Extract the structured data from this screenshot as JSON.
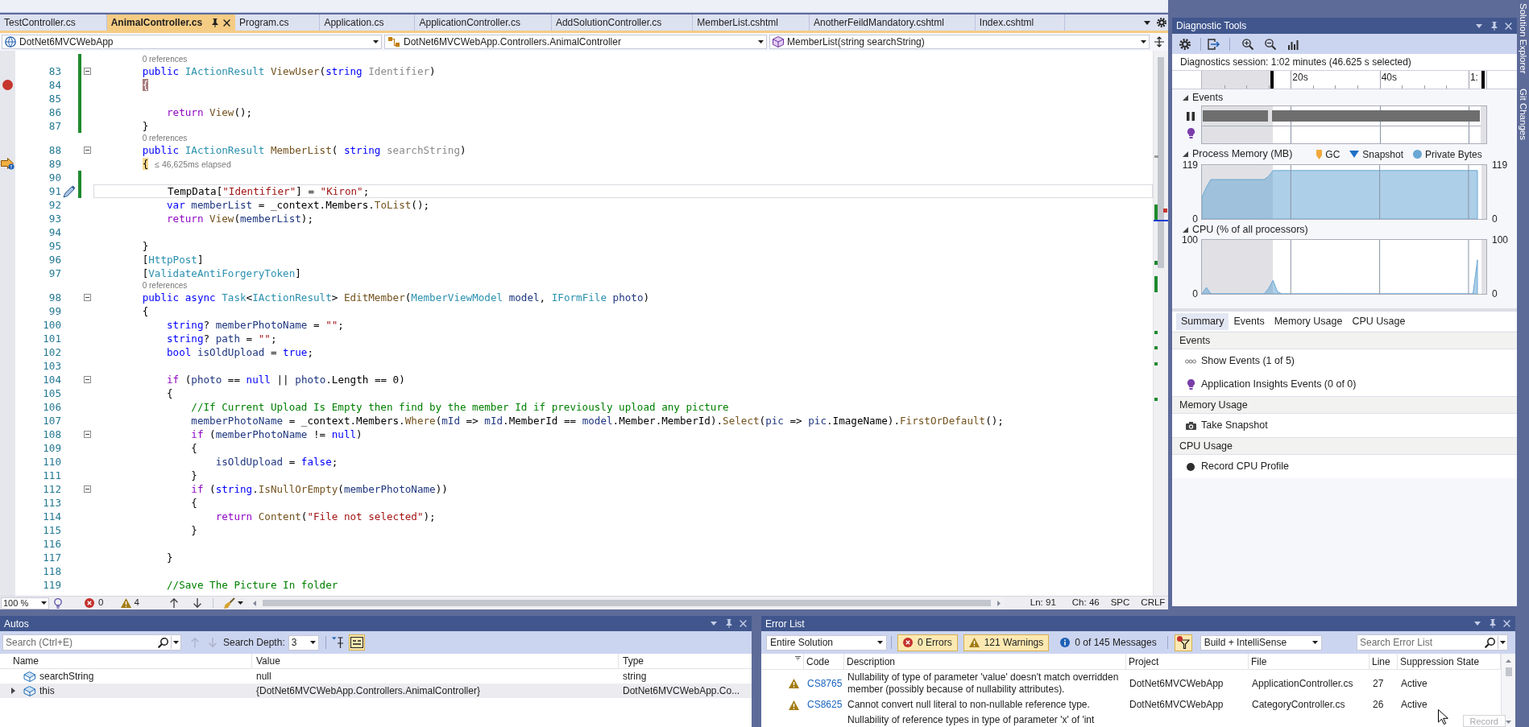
{
  "tabs": [
    {
      "label": "TestController.cs",
      "selected": false
    },
    {
      "label": "AnimalController.cs",
      "selected": true
    },
    {
      "label": "Program.cs",
      "selected": false
    },
    {
      "label": "Application.cs",
      "selected": false
    },
    {
      "label": "ApplicationController.cs",
      "selected": false
    },
    {
      "label": "AddSolutionController.cs",
      "selected": false
    },
    {
      "label": "MemberList.cshtml",
      "selected": false
    },
    {
      "label": "AnotherFeildMandatory.cshtml",
      "selected": false
    },
    {
      "label": "Index.cshtml",
      "selected": false
    }
  ],
  "navigation_bar": [
    {
      "kind": "project",
      "text": "DotNet6MVCWebApp"
    },
    {
      "kind": "type",
      "text": "DotNet6MVCWebApp.Controllers.AnimalController"
    },
    {
      "kind": "member",
      "text": "MemberList(string searchString)"
    }
  ],
  "editor": {
    "lines": [
      {
        "kind": "codelens",
        "text": "0 references",
        "changed": true
      },
      {
        "kind": "code",
        "number": "83",
        "changed": true,
        "collapsible": true,
        "current": false,
        "breakpoint": false,
        "current_statement": false,
        "edited": false,
        "tokens": [
          {
            "kind": "keyword",
            "text": "        public "
          },
          {
            "kind": "type",
            "text": "IActionResult "
          },
          {
            "kind": "method",
            "text": "ViewUser"
          },
          {
            "kind": "plain",
            "text": "("
          },
          {
            "kind": "keyword",
            "text": "string "
          },
          {
            "kind": "unused",
            "text": "Identifier"
          },
          {
            "kind": "plain",
            "text": ")"
          }
        ]
      },
      {
        "kind": "code",
        "number": "84",
        "changed": true,
        "collapsible": false,
        "current": false,
        "breakpoint": true,
        "current_statement": false,
        "edited": false,
        "tokens": [
          {
            "kind": "breakpoint_brace",
            "text": "        {"
          }
        ]
      },
      {
        "kind": "code",
        "number": "85",
        "changed": true,
        "collapsible": false,
        "current": false,
        "breakpoint": false,
        "current_statement": false,
        "edited": false
      },
      {
        "kind": "code",
        "number": "86",
        "changed": true,
        "collapsible": false,
        "current": false,
        "breakpoint": false,
        "current_statement": false,
        "edited": false,
        "tokens": [
          {
            "kind": "control",
            "text": "            return "
          },
          {
            "kind": "method",
            "text": "View"
          },
          {
            "kind": "plain",
            "text": "();"
          }
        ]
      },
      {
        "kind": "code",
        "number": "87",
        "changed": true,
        "collapsible": false,
        "current": false,
        "breakpoint": false,
        "current_statement": false,
        "edited": false,
        "tokens": [
          {
            "kind": "plain",
            "text": "        }"
          }
        ]
      },
      {
        "kind": "codelens",
        "text": "0 references",
        "changed": false
      },
      {
        "kind": "code",
        "number": "88",
        "changed": false,
        "collapsible": true,
        "current": false,
        "breakpoint": false,
        "current_statement": false,
        "edited": false,
        "tokens": [
          {
            "kind": "keyword",
            "text": "        public "
          },
          {
            "kind": "type",
            "text": "IActionResult "
          },
          {
            "kind": "method",
            "text": "MemberList"
          },
          {
            "kind": "plain",
            "text": "( "
          },
          {
            "kind": "keyword",
            "text": "string "
          },
          {
            "kind": "unused",
            "text": "searchString"
          },
          {
            "kind": "plain",
            "text": ")"
          }
        ]
      },
      {
        "kind": "code",
        "number": "89",
        "changed": false,
        "collapsible": false,
        "current": false,
        "breakpoint": false,
        "current_statement": true,
        "edited": false,
        "perf_tip": "≤ 46,625ms elapsed",
        "tokens": [
          {
            "kind": "current_brace",
            "text": "        {"
          }
        ]
      },
      {
        "kind": "code",
        "number": "90",
        "changed": true,
        "collapsible": false,
        "current": false,
        "breakpoint": false,
        "current_statement": false,
        "edited": false
      },
      {
        "kind": "code",
        "number": "91",
        "changed": true,
        "collapsible": false,
        "current": true,
        "breakpoint": false,
        "current_statement": false,
        "edited": true,
        "tokens": [
          {
            "kind": "plain",
            "text": "            TempData["
          },
          {
            "kind": "string",
            "text": "\"Identifier\""
          },
          {
            "kind": "plain",
            "text": "] = "
          },
          {
            "kind": "string",
            "text": "\"Kiron\""
          },
          {
            "kind": "plain",
            "text": ";"
          }
        ]
      },
      {
        "kind": "code",
        "number": "92",
        "changed": false,
        "collapsible": false,
        "current": false,
        "breakpoint": false,
        "current_statement": false,
        "edited": false,
        "tokens": [
          {
            "kind": "keyword",
            "text": "            var "
          },
          {
            "kind": "local",
            "text": "memberList"
          },
          {
            "kind": "plain",
            "text": " = _context.Members."
          },
          {
            "kind": "method",
            "text": "ToList"
          },
          {
            "kind": "plain",
            "text": "();"
          }
        ]
      },
      {
        "kind": "code",
        "number": "93",
        "changed": false,
        "collapsible": false,
        "current": false,
        "breakpoint": false,
        "current_statement": false,
        "edited": false,
        "tokens": [
          {
            "kind": "control",
            "text": "            return "
          },
          {
            "kind": "method",
            "text": "View"
          },
          {
            "kind": "plain",
            "text": "("
          },
          {
            "kind": "local",
            "text": "memberList"
          },
          {
            "kind": "plain",
            "text": ");"
          }
        ]
      },
      {
        "kind": "code",
        "number": "94",
        "changed": false,
        "collapsible": false,
        "current": false,
        "breakpoint": false,
        "current_statement": false,
        "edited": false
      },
      {
        "kind": "code",
        "number": "95",
        "changed": false,
        "collapsible": false,
        "current": false,
        "breakpoint": false,
        "current_statement": false,
        "edited": false,
        "tokens": [
          {
            "kind": "plain",
            "text": "        }"
          }
        ]
      },
      {
        "kind": "code",
        "number": "96",
        "changed": false,
        "collapsible": false,
        "current": false,
        "breakpoint": false,
        "current_statement": false,
        "edited": false,
        "tokens": [
          {
            "kind": "plain",
            "text": "        ["
          },
          {
            "kind": "type",
            "text": "HttpPost"
          },
          {
            "kind": "plain",
            "text": "]"
          }
        ]
      },
      {
        "kind": "code",
        "number": "97",
        "changed": false,
        "collapsible": false,
        "current": false,
        "breakpoint": false,
        "current_statement": false,
        "edited": false,
        "tokens": [
          {
            "kind": "plain",
            "text": "        ["
          },
          {
            "kind": "type",
            "text": "ValidateAntiForgeryToken"
          },
          {
            "kind": "plain",
            "text": "]"
          }
        ]
      },
      {
        "kind": "codelens",
        "text": "0 references",
        "changed": false
      },
      {
        "kind": "code",
        "number": "98",
        "changed": false,
        "collapsible": true,
        "current": false,
        "breakpoint": false,
        "current_statement": false,
        "edited": false,
        "tokens": [
          {
            "kind": "keyword",
            "text": "        public async "
          },
          {
            "kind": "type",
            "text": "Task"
          },
          {
            "kind": "plain",
            "text": "<"
          },
          {
            "kind": "type",
            "text": "IActionResult"
          },
          {
            "kind": "plain",
            "text": "> "
          },
          {
            "kind": "method",
            "text": "EditMember"
          },
          {
            "kind": "plain",
            "text": "("
          },
          {
            "kind": "type",
            "text": "MemberViewModel "
          },
          {
            "kind": "local",
            "text": "model"
          },
          {
            "kind": "plain",
            "text": ", "
          },
          {
            "kind": "type",
            "text": "IFormFile "
          },
          {
            "kind": "local",
            "text": "photo"
          },
          {
            "kind": "plain",
            "text": ")"
          }
        ]
      },
      {
        "kind": "code",
        "number": "99",
        "changed": false,
        "collapsible": false,
        "current": false,
        "breakpoint": false,
        "current_statement": false,
        "edited": false,
        "tokens": [
          {
            "kind": "plain",
            "text": "        {"
          }
        ]
      },
      {
        "kind": "code",
        "number": "100",
        "changed": false,
        "collapsible": false,
        "current": false,
        "breakpoint": false,
        "current_statement": false,
        "edited": false,
        "tokens": [
          {
            "kind": "keyword",
            "text": "            string"
          },
          {
            "kind": "plain",
            "text": "? "
          },
          {
            "kind": "local",
            "text": "memberPhotoName"
          },
          {
            "kind": "plain",
            "text": " = "
          },
          {
            "kind": "string",
            "text": "\"\""
          },
          {
            "kind": "plain",
            "text": ";"
          }
        ]
      },
      {
        "kind": "code",
        "number": "101",
        "changed": false,
        "collapsible": false,
        "current": false,
        "breakpoint": false,
        "current_statement": false,
        "edited": false,
        "tokens": [
          {
            "kind": "keyword",
            "text": "            string"
          },
          {
            "kind": "plain",
            "text": "? "
          },
          {
            "kind": "local",
            "text": "path"
          },
          {
            "kind": "plain",
            "text": " = "
          },
          {
            "kind": "string",
            "text": "\"\""
          },
          {
            "kind": "plain",
            "text": ";"
          }
        ]
      },
      {
        "kind": "code",
        "number": "102",
        "changed": false,
        "collapsible": false,
        "current": false,
        "breakpoint": false,
        "current_statement": false,
        "edited": false,
        "tokens": [
          {
            "kind": "keyword",
            "text": "            bool "
          },
          {
            "kind": "local",
            "text": "isOldUpload"
          },
          {
            "kind": "plain",
            "text": " = "
          },
          {
            "kind": "keyword",
            "text": "true"
          },
          {
            "kind": "plain",
            "text": ";"
          }
        ]
      },
      {
        "kind": "code",
        "number": "103",
        "changed": false,
        "collapsible": false,
        "current": false,
        "breakpoint": false,
        "current_statement": false,
        "edited": false
      },
      {
        "kind": "code",
        "number": "104",
        "changed": false,
        "collapsible": true,
        "current": false,
        "breakpoint": false,
        "current_statement": false,
        "edited": false,
        "tokens": [
          {
            "kind": "control",
            "text": "            if "
          },
          {
            "kind": "plain",
            "text": "("
          },
          {
            "kind": "local",
            "text": "photo"
          },
          {
            "kind": "plain",
            "text": " == "
          },
          {
            "kind": "keyword",
            "text": "null"
          },
          {
            "kind": "plain",
            "text": " || "
          },
          {
            "kind": "local",
            "text": "photo"
          },
          {
            "kind": "plain",
            "text": ".Length == 0)"
          }
        ]
      },
      {
        "kind": "code",
        "number": "105",
        "changed": false,
        "collapsible": false,
        "current": false,
        "breakpoint": false,
        "current_statement": false,
        "edited": false,
        "tokens": [
          {
            "kind": "plain",
            "text": "            {"
          }
        ]
      },
      {
        "kind": "code",
        "number": "106",
        "changed": false,
        "collapsible": false,
        "current": false,
        "breakpoint": false,
        "current_statement": false,
        "edited": false,
        "tokens": [
          {
            "kind": "comment",
            "text": "                //If Current Upload Is Empty then find by the member Id if previously upload any picture"
          }
        ]
      },
      {
        "kind": "code",
        "number": "107",
        "changed": false,
        "collapsible": false,
        "current": false,
        "breakpoint": false,
        "current_statement": false,
        "edited": false,
        "tokens": [
          {
            "kind": "local",
            "text": "                memberPhotoName"
          },
          {
            "kind": "plain",
            "text": " = _context.Members."
          },
          {
            "kind": "method",
            "text": "Where"
          },
          {
            "kind": "plain",
            "text": "("
          },
          {
            "kind": "local",
            "text": "mId"
          },
          {
            "kind": "plain",
            "text": " => "
          },
          {
            "kind": "local",
            "text": "mId"
          },
          {
            "kind": "plain",
            "text": ".MemberId == "
          },
          {
            "kind": "local",
            "text": "model"
          },
          {
            "kind": "plain",
            "text": ".Member.MemberId)."
          },
          {
            "kind": "method",
            "text": "Select"
          },
          {
            "kind": "plain",
            "text": "("
          },
          {
            "kind": "local",
            "text": "pic"
          },
          {
            "kind": "plain",
            "text": " => "
          },
          {
            "kind": "local",
            "text": "pic"
          },
          {
            "kind": "plain",
            "text": ".ImageName)."
          },
          {
            "kind": "method",
            "text": "FirstOrDefault"
          },
          {
            "kind": "plain",
            "text": "();"
          }
        ]
      },
      {
        "kind": "code",
        "number": "108",
        "changed": false,
        "collapsible": true,
        "current": false,
        "breakpoint": false,
        "current_statement": false,
        "edited": false,
        "tokens": [
          {
            "kind": "control",
            "text": "                if "
          },
          {
            "kind": "plain",
            "text": "("
          },
          {
            "kind": "local",
            "text": "memberPhotoName"
          },
          {
            "kind": "plain",
            "text": " != "
          },
          {
            "kind": "keyword",
            "text": "null"
          },
          {
            "kind": "plain",
            "text": ")"
          }
        ]
      },
      {
        "kind": "code",
        "number": "109",
        "changed": false,
        "collapsible": false,
        "current": false,
        "breakpoint": false,
        "current_statement": false,
        "edited": false,
        "tokens": [
          {
            "kind": "plain",
            "text": "                {"
          }
        ]
      },
      {
        "kind": "code",
        "number": "110",
        "changed": false,
        "collapsible": false,
        "current": false,
        "breakpoint": false,
        "current_statement": false,
        "edited": false,
        "tokens": [
          {
            "kind": "local",
            "text": "                    isOldUpload"
          },
          {
            "kind": "plain",
            "text": " = "
          },
          {
            "kind": "keyword",
            "text": "false"
          },
          {
            "kind": "plain",
            "text": ";"
          }
        ]
      },
      {
        "kind": "code",
        "number": "111",
        "changed": false,
        "collapsible": false,
        "current": false,
        "breakpoint": false,
        "current_statement": false,
        "edited": false,
        "tokens": [
          {
            "kind": "plain",
            "text": "                }"
          }
        ]
      },
      {
        "kind": "code",
        "number": "112",
        "changed": false,
        "collapsible": true,
        "current": false,
        "breakpoint": false,
        "current_statement": false,
        "edited": false,
        "tokens": [
          {
            "kind": "control",
            "text": "                if "
          },
          {
            "kind": "plain",
            "text": "("
          },
          {
            "kind": "keyword",
            "text": "string"
          },
          {
            "kind": "plain",
            "text": "."
          },
          {
            "kind": "method",
            "text": "IsNullOrEmpty"
          },
          {
            "kind": "plain",
            "text": "("
          },
          {
            "kind": "local",
            "text": "memberPhotoName"
          },
          {
            "kind": "plain",
            "text": "))"
          }
        ]
      },
      {
        "kind": "code",
        "number": "113",
        "changed": false,
        "collapsible": false,
        "current": false,
        "breakpoint": false,
        "current_statement": false,
        "edited": false,
        "tokens": [
          {
            "kind": "plain",
            "text": "                {"
          }
        ]
      },
      {
        "kind": "code",
        "number": "114",
        "changed": false,
        "collapsible": false,
        "current": false,
        "breakpoint": false,
        "current_statement": false,
        "edited": false,
        "tokens": [
          {
            "kind": "control",
            "text": "                    return "
          },
          {
            "kind": "method",
            "text": "Content"
          },
          {
            "kind": "plain",
            "text": "("
          },
          {
            "kind": "string",
            "text": "\"File not selected\""
          },
          {
            "kind": "plain",
            "text": ");"
          }
        ]
      },
      {
        "kind": "code",
        "number": "115",
        "changed": false,
        "collapsible": false,
        "current": false,
        "breakpoint": false,
        "current_statement": false,
        "edited": false,
        "tokens": [
          {
            "kind": "plain",
            "text": "                }"
          }
        ]
      },
      {
        "kind": "code",
        "number": "116",
        "changed": false,
        "collapsible": false,
        "current": false,
        "breakpoint": false,
        "current_statement": false,
        "edited": false
      },
      {
        "kind": "code",
        "number": "117",
        "changed": false,
        "collapsible": false,
        "current": false,
        "breakpoint": false,
        "current_statement": false,
        "edited": false,
        "tokens": [
          {
            "kind": "plain",
            "text": "            }"
          }
        ]
      },
      {
        "kind": "code",
        "number": "118",
        "changed": false,
        "collapsible": false,
        "current": false,
        "breakpoint": false,
        "current_statement": false,
        "edited": false
      },
      {
        "kind": "code",
        "number": "119",
        "changed": false,
        "collapsible": false,
        "current": false,
        "breakpoint": false,
        "current_statement": false,
        "edited": false,
        "tokens": [
          {
            "kind": "comment",
            "text": "            //Save The Picture In folder"
          }
        ]
      }
    ],
    "status_bar": {
      "zoom": "100 %",
      "errors": "0",
      "warnings": "4",
      "line": "Ln: 91",
      "column": "Ch: 46",
      "whitespace": "SPC",
      "line_ending": "CRLF"
    }
  },
  "diagnostic_tools": {
    "title": "Diagnostic Tools",
    "session": "Diagnostics session: 1:02 minutes (46.625 s selected)",
    "timeline_ticks": [
      "20s",
      "40s",
      "1:"
    ],
    "events_title": "Events",
    "memory": {
      "title": "Process Memory (MB)",
      "legend": [
        {
          "kind": "gc",
          "label": "GC"
        },
        {
          "kind": "snapshot",
          "label": "Snapshot"
        },
        {
          "kind": "private_bytes",
          "label": "Private Bytes"
        }
      ],
      "axis_labels": [
        "119",
        "0"
      ],
      "right_axis_labels": [
        "119",
        "0"
      ]
    },
    "cpu": {
      "right_axis_labels": [
        "100",
        "0"
      ],
      "chart_data": {
        "type": "area",
        "title": "CPU (% of all processors)",
        "categories": [
          null,
          null,
          null,
          null,
          null,
          null,
          null,
          null,
          null,
          null,
          null,
          null,
          null,
          null,
          null,
          null,
          null,
          null,
          null,
          null,
          null,
          null,
          null,
          null,
          null,
          null,
          null,
          null,
          null,
          null,
          null,
          null,
          null,
          null,
          null,
          null,
          null,
          null,
          null,
          null,
          null,
          null,
          null,
          null,
          null,
          null,
          null,
          null,
          null,
          null,
          null,
          null,
          null,
          null,
          null,
          null,
          null,
          null,
          null,
          null,
          null,
          null,
          null,
          null
        ],
        "series": [
          {
            "color": "#6aa7d4",
            "values": [
              0,
              12,
              0,
              0,
              0,
              0,
              0,
              0,
              0,
              0,
              0,
              0,
              0,
              0,
              0,
              10,
              25,
              4,
              0,
              0,
              0,
              0,
              0,
              0,
              0,
              0,
              0,
              0,
              0,
              0,
              0,
              0,
              0,
              0,
              0,
              0,
              0,
              0,
              0,
              0,
              0,
              0,
              0,
              0,
              0,
              0,
              0,
              0,
              0,
              0,
              0,
              0,
              0,
              0,
              0,
              0,
              0,
              0,
              0,
              0,
              0,
              0,
              63,
              null
            ]
          }
        ],
        "ylim": [
          0,
          100
        ],
        "yticks": [
          0,
          100
        ],
        "grid": true
      }
    },
    "tabs": [
      {
        "label": "Summary",
        "selected": true
      },
      {
        "label": "Events",
        "selected": false
      },
      {
        "label": "Memory Usage",
        "selected": false
      },
      {
        "label": "CPU Usage",
        "selected": false
      }
    ],
    "sections": [
      {
        "title": "Events",
        "items": [
          {
            "kind": "events",
            "label": "Show Events (1 of 5)"
          },
          {
            "kind": "insights",
            "label": "Application Insights Events (0 of 0)"
          }
        ]
      },
      {
        "title": "Memory Usage",
        "items": [
          {
            "kind": "snapshot",
            "label": "Take Snapshot"
          }
        ]
      },
      {
        "title": "CPU Usage",
        "items": [
          {
            "kind": "record",
            "label": "Record CPU Profile"
          }
        ]
      }
    ]
  },
  "autos": {
    "title": "Autos",
    "search_placeholder": "Search (Ctrl+E)",
    "search_depth_label": "Search Depth:",
    "search_depth": "3",
    "toggles": [
      {
        "kind": "pin",
        "on": false
      },
      {
        "kind": "text",
        "on": true
      }
    ],
    "columns": [
      "Name",
      "Value",
      "Type"
    ],
    "rows": [
      {
        "name": "searchString",
        "value": "null",
        "type": "string",
        "expandable": false,
        "selected": false
      },
      {
        "name": "this",
        "value": "{DotNet6MVCWebApp.Controllers.AnimalController}",
        "type": "DotNet6MVCWebApp.Co...",
        "expandable": true,
        "selected": true
      }
    ]
  },
  "error_list": {
    "title": "Error List",
    "scope": "Entire Solution",
    "filters": [
      {
        "kind": "error",
        "label": "0 Errors",
        "on": true
      },
      {
        "kind": "warning",
        "label": "121 Warnings",
        "on": true
      },
      {
        "kind": "message",
        "label": "0 of 145 Messages",
        "on": false
      }
    ],
    "filter_on": true,
    "source": "Build + IntelliSense",
    "search_placeholder": "Search Error List",
    "columns": [
      "Code",
      "Description",
      "Project",
      "File",
      "Line",
      "Suppression State"
    ],
    "rows": [
      {
        "kind": "warning",
        "code": "CS8765",
        "description": "Nullability of type of parameter 'value' doesn't match overridden member (possibly because of nullability attributes).",
        "project": "DotNet6MVCWebApp",
        "file": "ApplicationController.cs",
        "line": "27",
        "suppression": "Active"
      },
      {
        "kind": "warning",
        "code": "CS8625",
        "description": "Cannot convert null literal to non-nullable reference type.",
        "project": "DotNet6MVCWebApp",
        "file": "CategoryController.cs",
        "line": "26",
        "suppression": "Active"
      },
      {
        "description": "Nullability of reference types in type of parameter 'x' of 'int"
      }
    ]
  },
  "recording_control": {
    "label": "Record"
  },
  "side_tabs": [
    "Solution Explorer",
    "Git Changes"
  ]
}
